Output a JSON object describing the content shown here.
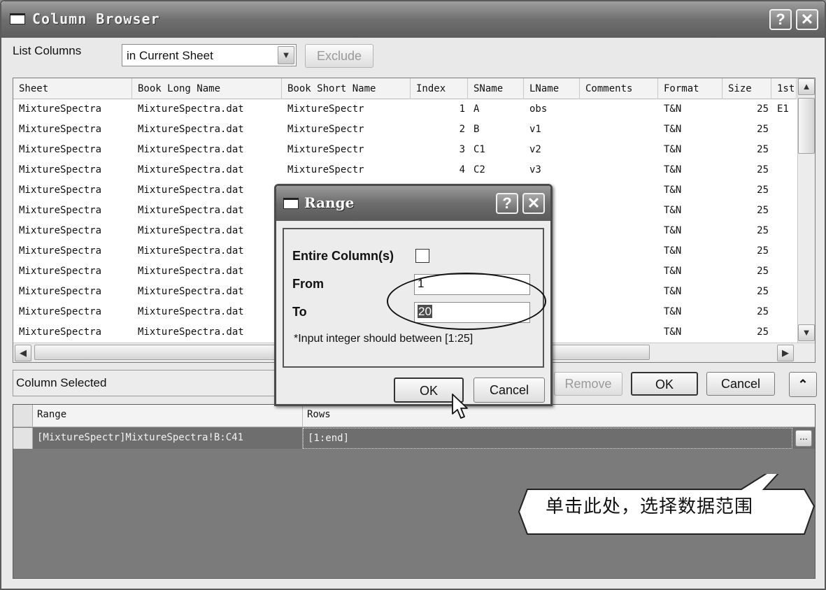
{
  "window": {
    "title": "Column Browser",
    "help": "?",
    "close": "✕"
  },
  "top": {
    "list_columns_label": "List Columns",
    "scope_value": "in Current Sheet",
    "exclude_label": "Exclude"
  },
  "grid": {
    "headers": [
      "Sheet",
      "Book Long Name",
      "Book Short Name",
      "Index",
      "SName",
      "LName",
      "Comments",
      "Format",
      "Size",
      "1st"
    ],
    "rows": [
      {
        "sheet": "MixtureSpectra",
        "long": "MixtureSpectra.dat",
        "short": "MixtureSpectr",
        "index": "1",
        "sname": "A",
        "lname": "obs",
        "format": "T&N",
        "size": "25",
        "first": "E1"
      },
      {
        "sheet": "MixtureSpectra",
        "long": "MixtureSpectra.dat",
        "short": "MixtureSpectr",
        "index": "2",
        "sname": "B",
        "lname": "v1",
        "format": "T&N",
        "size": "25",
        "first": ""
      },
      {
        "sheet": "MixtureSpectra",
        "long": "MixtureSpectra.dat",
        "short": "MixtureSpectr",
        "index": "3",
        "sname": "C1",
        "lname": "v2",
        "format": "T&N",
        "size": "25",
        "first": ""
      },
      {
        "sheet": "MixtureSpectra",
        "long": "MixtureSpectra.dat",
        "short": "MixtureSpectr",
        "index": "4",
        "sname": "C2",
        "lname": "v3",
        "format": "T&N",
        "size": "25",
        "first": ""
      },
      {
        "sheet": "MixtureSpectra",
        "long": "MixtureSpectra.dat",
        "short": "",
        "index": "",
        "sname": "",
        "lname": "",
        "format": "T&N",
        "size": "25",
        "first": ""
      },
      {
        "sheet": "MixtureSpectra",
        "long": "MixtureSpectra.dat",
        "short": "",
        "index": "",
        "sname": "",
        "lname": "",
        "format": "T&N",
        "size": "25",
        "first": ""
      },
      {
        "sheet": "MixtureSpectra",
        "long": "MixtureSpectra.dat",
        "short": "",
        "index": "",
        "sname": "",
        "lname": "",
        "format": "T&N",
        "size": "25",
        "first": ""
      },
      {
        "sheet": "MixtureSpectra",
        "long": "MixtureSpectra.dat",
        "short": "",
        "index": "",
        "sname": "",
        "lname": "",
        "format": "T&N",
        "size": "25",
        "first": ""
      },
      {
        "sheet": "MixtureSpectra",
        "long": "MixtureSpectra.dat",
        "short": "",
        "index": "",
        "sname": "",
        "lname": "",
        "format": "T&N",
        "size": "25",
        "first": ""
      },
      {
        "sheet": "MixtureSpectra",
        "long": "MixtureSpectra.dat",
        "short": "",
        "index": "",
        "sname": "",
        "lname": "",
        "format": "T&N",
        "size": "25",
        "first": ""
      },
      {
        "sheet": "MixtureSpectra",
        "long": "MixtureSpectra.dat",
        "short": "",
        "index": "",
        "sname": "",
        "lname": "",
        "format": "T&N",
        "size": "25",
        "first": ""
      },
      {
        "sheet": "MixtureSpectra",
        "long": "MixtureSpectra.dat",
        "short": "",
        "index": "",
        "sname": "",
        "lname": "",
        "format": "T&N",
        "size": "25",
        "first": ""
      }
    ]
  },
  "selected": {
    "label": "Column Selected",
    "remove_label": "Remove",
    "ok_label": "OK",
    "cancel_label": "Cancel",
    "collapse_icon": "⌃",
    "headers": [
      "Range",
      "Rows"
    ],
    "row": {
      "range": "[MixtureSpectr]MixtureSpectra!B:C41",
      "rows": "[1:end]"
    },
    "ellipsis": "..."
  },
  "range_dialog": {
    "title": "Range",
    "entire_label": "Entire Column(s)",
    "from_label": "From",
    "from_value": "1",
    "to_label": "To",
    "to_value": "20",
    "hint": "*Input integer should between [1:25]",
    "ok_label": "OK",
    "cancel_label": "Cancel"
  },
  "callout": {
    "text": "单击此处，选择数据范围"
  }
}
